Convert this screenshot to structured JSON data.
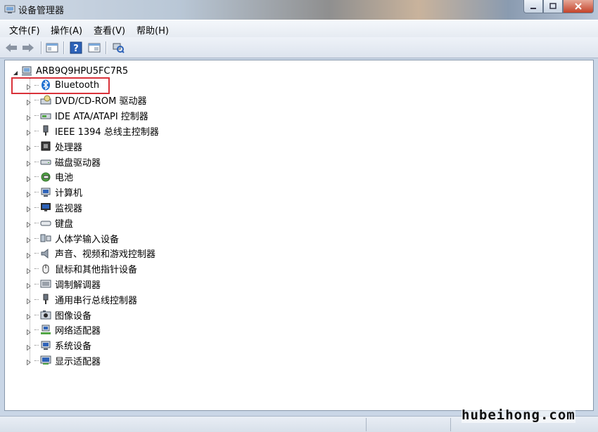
{
  "window": {
    "title": "设备管理器"
  },
  "menu": [
    {
      "label": "文件(F)"
    },
    {
      "label": "操作(A)"
    },
    {
      "label": "查看(V)"
    },
    {
      "label": "帮助(H)"
    }
  ],
  "tree": {
    "root": "ARB9Q9HPU5FC7R5",
    "items": [
      {
        "label": "Bluetooth",
        "icon": "bluetooth-icon"
      },
      {
        "label": "DVD/CD-ROM 驱动器",
        "icon": "optical-drive-icon"
      },
      {
        "label": "IDE ATA/ATAPI 控制器",
        "icon": "ide-controller-icon"
      },
      {
        "label": "IEEE 1394 总线主控制器",
        "icon": "ieee1394-icon"
      },
      {
        "label": "处理器",
        "icon": "processor-icon"
      },
      {
        "label": "磁盘驱动器",
        "icon": "disk-drive-icon"
      },
      {
        "label": "电池",
        "icon": "battery-icon"
      },
      {
        "label": "计算机",
        "icon": "computer-icon"
      },
      {
        "label": "监视器",
        "icon": "monitor-icon"
      },
      {
        "label": "键盘",
        "icon": "keyboard-icon"
      },
      {
        "label": "人体学输入设备",
        "icon": "hid-icon"
      },
      {
        "label": "声音、视频和游戏控制器",
        "icon": "speaker-icon"
      },
      {
        "label": "鼠标和其他指针设备",
        "icon": "mouse-icon"
      },
      {
        "label": "调制解调器",
        "icon": "modem-icon"
      },
      {
        "label": "通用串行总线控制器",
        "icon": "usb-icon"
      },
      {
        "label": "图像设备",
        "icon": "imaging-device-icon"
      },
      {
        "label": "网络适配器",
        "icon": "network-adapter-icon"
      },
      {
        "label": "系统设备",
        "icon": "system-device-icon"
      },
      {
        "label": "显示适配器",
        "icon": "display-adapter-icon"
      }
    ]
  },
  "watermark": "hubeihong.com",
  "colors": {
    "highlight": "#d9323a",
    "accent": "#1f6fd0"
  }
}
